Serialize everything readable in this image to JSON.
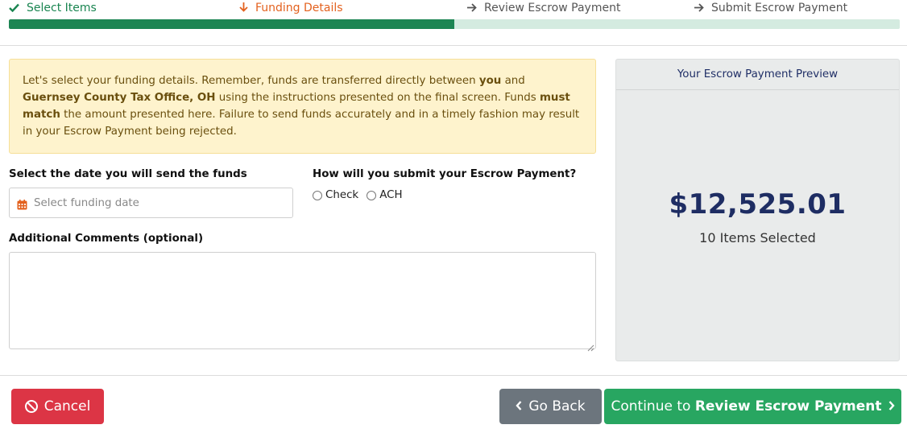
{
  "stepper": {
    "steps": [
      {
        "label": "Select Items",
        "icon": "check-icon",
        "state": "done"
      },
      {
        "label": "Funding Details",
        "icon": "arrow-down-icon",
        "state": "current"
      },
      {
        "label": "Review Escrow Payment",
        "icon": "arrow-right-icon",
        "state": "upcoming"
      },
      {
        "label": "Submit Escrow Payment",
        "icon": "arrow-right-icon",
        "state": "upcoming"
      }
    ],
    "progress_fraction": 0.5,
    "colors": {
      "done": "#1a8551",
      "current": "#e3611e",
      "upcoming": "#555555",
      "bar_fill": "#1c8553",
      "bar_track": "#d4ebe0"
    }
  },
  "alert": {
    "part1": "Let's select your funding details. Remember, funds are transferred directly between ",
    "bold1": "you",
    "part2": " and ",
    "bold2": "Guernsey County Tax Office, OH",
    "part3": " using the instructions presented on the final screen. Funds ",
    "bold3": "must match",
    "part4": " the amount presented here. Failure to send funds accurately and in a timely fashion may result in your Escrow Payment being rejected."
  },
  "form": {
    "date_label": "Select the date you will send the funds",
    "date_placeholder": "Select funding date",
    "date_icon": "calendar-icon",
    "method_label": "How will you submit your Escrow Payment?",
    "method_options": [
      "Check",
      "ACH"
    ],
    "comments_label": "Additional Comments (optional)",
    "comments_value": ""
  },
  "preview": {
    "title": "Your Escrow Payment Preview",
    "amount": "$12,525.01",
    "items_selected": "10 Items Selected"
  },
  "buttons": {
    "cancel": "Cancel",
    "cancel_icon": "ban-icon",
    "back": "Go Back",
    "back_icon": "chevron-left-icon",
    "continue_prefix": "Continue to ",
    "continue_bold": "Review Escrow Payment",
    "continue_icon": "chevron-right-icon"
  },
  "colors": {
    "cancel": "#dc3545",
    "back": "#6c757d",
    "continue": "#28a661",
    "alert_bg": "#fef3cd",
    "amount": "#1e2d63"
  }
}
